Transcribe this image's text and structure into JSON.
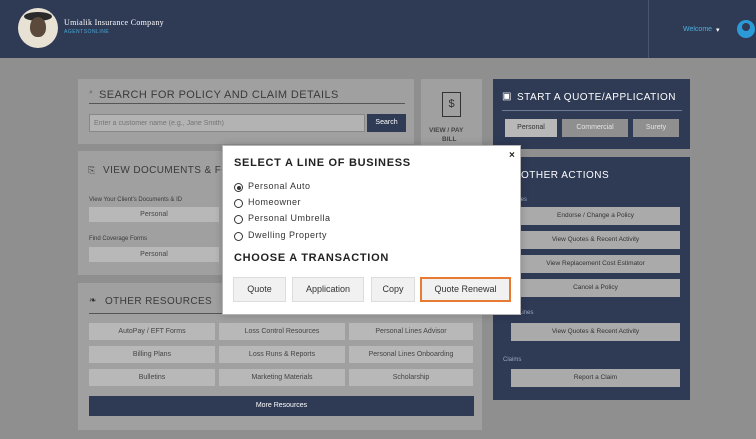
{
  "header": {
    "company": "Umialik Insurance Company",
    "subtitle": "AGENTSONLINE",
    "welcome": "Welcome",
    "caret": "▾"
  },
  "search": {
    "title": "SEARCH FOR POLICY AND CLAIM DETAILS",
    "placeholder": "Enter a customer name (e.g., Jane Smith)",
    "button": "Search"
  },
  "view_pay": {
    "icon_text": "$",
    "label_top": "VIEW / PAY",
    "label_bottom": "BILL"
  },
  "view_docs": {
    "title": "VIEW DOCUMENTS & FO",
    "label1": "View Your Client's Documents & ID",
    "btn1": "Personal",
    "label2": "Find Coverage Forms",
    "btn2": "Personal"
  },
  "resources": {
    "title": "OTHER RESOURCES",
    "items": [
      "AutoPay / EFT Forms",
      "Loss Control Resources",
      "Personal Lines Advisor",
      "Billing Plans",
      "Loss Runs & Reports",
      "Personal Lines Onboarding",
      "Bulletins",
      "Marketing Materials",
      "Scholarship"
    ],
    "more": "More Resources"
  },
  "quote": {
    "title": "START A QUOTE/APPLICATION",
    "tabs": [
      "Personal",
      "Commercial",
      "Surety"
    ]
  },
  "other_actions": {
    "title": "OTHER ACTIONS",
    "personal_label": "nal Lines",
    "personal_items": [
      "Endorse / Change a Policy",
      "View Quotes & Recent Activity",
      "View Replacement Cost Estimator",
      "Cancel a Policy"
    ],
    "commercial_label": "ercial Lines",
    "commercial_items": [
      "View Quotes & Recent Activity"
    ],
    "claims_label": "Claims",
    "claims_items": [
      "Report a Claim"
    ]
  },
  "modal": {
    "title": "SELECT A LINE OF BUSINESS",
    "options": [
      "Personal Auto",
      "Homeowner",
      "Personal Umbrella",
      "Dwelling Property"
    ],
    "selected": "Personal Auto",
    "transaction_title": "CHOOSE A TRANSACTION",
    "transactions": [
      "Quote",
      "Application",
      "Copy",
      "Quote Renewal"
    ],
    "highlighted": "Quote Renewal",
    "close": "×"
  },
  "colors": {
    "navy": "#2f3a55",
    "accent": "#49a8d8",
    "highlight": "#e87b34"
  }
}
